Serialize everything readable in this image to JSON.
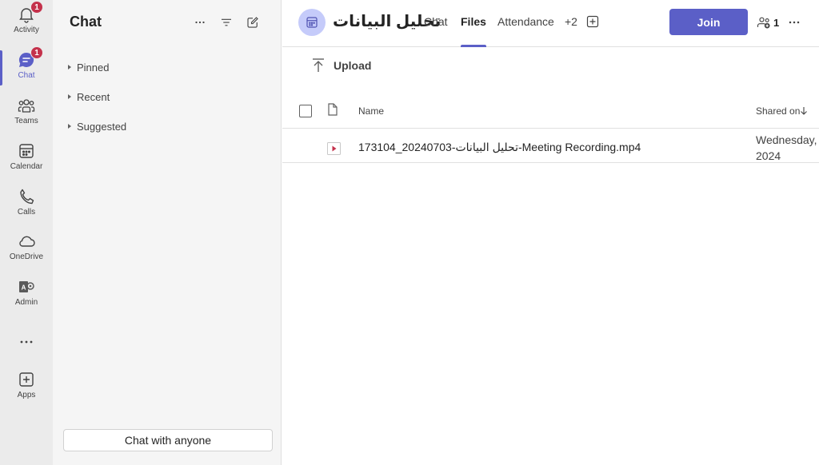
{
  "rail": {
    "items": [
      {
        "label": "Activity",
        "icon": "bell-icon",
        "badge": "1"
      },
      {
        "label": "Chat",
        "icon": "chat-icon",
        "badge": "1"
      },
      {
        "label": "Teams",
        "icon": "teams-icon"
      },
      {
        "label": "Calendar",
        "icon": "calendar-icon"
      },
      {
        "label": "Calls",
        "icon": "phone-icon"
      },
      {
        "label": "OneDrive",
        "icon": "cloud-icon"
      },
      {
        "label": "Admin",
        "icon": "admin-icon"
      },
      {
        "label": "Apps",
        "icon": "plus-square-icon"
      }
    ],
    "active": "Chat"
  },
  "chat_panel": {
    "title": "Chat",
    "sections": [
      "Pinned",
      "Recent",
      "Suggested"
    ],
    "chat_anyone": "Chat with anyone"
  },
  "header": {
    "title": "تحليل البيانات",
    "tabs": [
      "Chat",
      "Files",
      "Attendance",
      "+2"
    ],
    "active_tab": "Files",
    "join": "Join",
    "participants": "1"
  },
  "toolbar": {
    "upload": "Upload"
  },
  "table": {
    "columns": {
      "name": "Name",
      "shared_on": "Shared on"
    },
    "rows": [
      {
        "name": "تحليل البيانات-20240703_173104-Meeting Recording.mp4",
        "shared_on_line1": "Wednesday,",
        "shared_on_line2": "2024"
      }
    ]
  },
  "colors": {
    "accent": "#5b5fc7",
    "badge": "#c4314b",
    "rail_bg": "#ebebeb",
    "panel_bg": "#f5f5f5"
  }
}
